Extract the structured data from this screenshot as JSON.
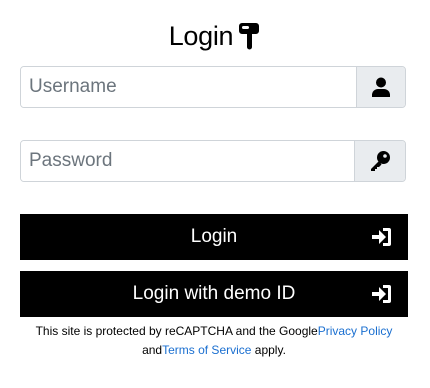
{
  "header": {
    "title": "Login",
    "icon": "hand-pointing-down-icon"
  },
  "form": {
    "username_placeholder": "Username",
    "username_icon": "user-icon",
    "password_placeholder": "Password",
    "password_icon": "key-icon"
  },
  "buttons": {
    "login_label": "Login",
    "login_icon": "sign-in-icon",
    "demo_label": "Login with demo ID",
    "demo_icon": "sign-in-icon"
  },
  "recaptcha": {
    "prefix": "This site is protected by reCAPTCHA and the Google",
    "privacy_link": "Privacy Policy",
    "middle": " and",
    "terms_link": "Terms of Service",
    "suffix": " apply."
  },
  "colors": {
    "button_bg": "#000000",
    "link": "#1a6fd0",
    "addon_bg": "#e9ecef"
  }
}
